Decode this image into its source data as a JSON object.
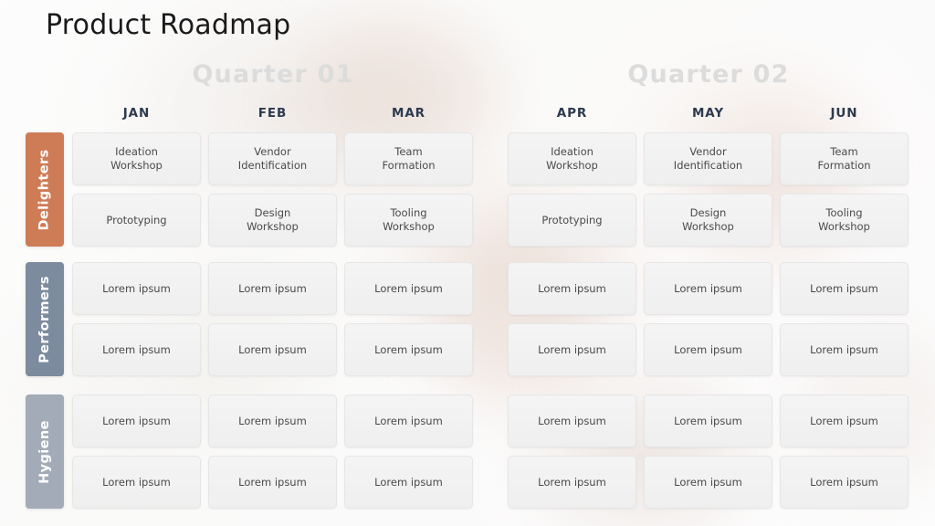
{
  "title": "Product Roadmap",
  "colors": {
    "title_text": "#1a1a1a",
    "quarter_text": "#dcdcdc",
    "month_text": "#2d3a4e",
    "card_bg": "#f1f1f1",
    "card_text": "#4a4a4a",
    "delighters_bar": "#ce7c56",
    "performers_bar": "#7d8b9e",
    "hygiene_bar": "#a3abb8"
  },
  "quarters": [
    {
      "label": "Quarter 01",
      "months": [
        "JAN",
        "FEB",
        "MAR"
      ]
    },
    {
      "label": "Quarter 02",
      "months": [
        "APR",
        "MAY",
        "JUN"
      ]
    }
  ],
  "categories": [
    {
      "label": "Delighters",
      "color": "#ce7c56"
    },
    {
      "label": "Performers",
      "color": "#7d8b9e"
    },
    {
      "label": "Hygiene",
      "color": "#a3abb8"
    }
  ],
  "grid": [
    {
      "category": "Delighters",
      "rows": [
        [
          "Ideation\nWorkshop",
          "Vendor\nIdentification",
          "Team\nFormation",
          "Ideation\nWorkshop",
          "Vendor\nIdentification",
          "Team\nFormation"
        ],
        [
          "Prototyping",
          "Design\nWorkshop",
          "Tooling\nWorkshop",
          "Prototyping",
          "Design\nWorkshop",
          "Tooling\nWorkshop"
        ]
      ]
    },
    {
      "category": "Performers",
      "rows": [
        [
          "Lorem ipsum",
          "Lorem ipsum",
          "Lorem ipsum",
          "Lorem ipsum",
          "Lorem ipsum",
          "Lorem ipsum"
        ],
        [
          "Lorem ipsum",
          "Lorem ipsum",
          "Lorem ipsum",
          "Lorem ipsum",
          "Lorem ipsum",
          "Lorem ipsum"
        ]
      ]
    },
    {
      "category": "Hygiene",
      "rows": [
        [
          "Lorem ipsum",
          "Lorem ipsum",
          "Lorem ipsum",
          "Lorem ipsum",
          "Lorem ipsum",
          "Lorem ipsum"
        ],
        [
          "Lorem ipsum",
          "Lorem ipsum",
          "Lorem ipsum",
          "Lorem ipsum",
          "Lorem ipsum",
          "Lorem ipsum"
        ]
      ]
    }
  ],
  "layout": {
    "column_x": [
      79,
      228,
      377,
      556,
      705,
      854
    ],
    "band_top": [
      145,
      287,
      432
    ],
    "row_offset": [
      0,
      67
    ],
    "band_height": 125
  }
}
